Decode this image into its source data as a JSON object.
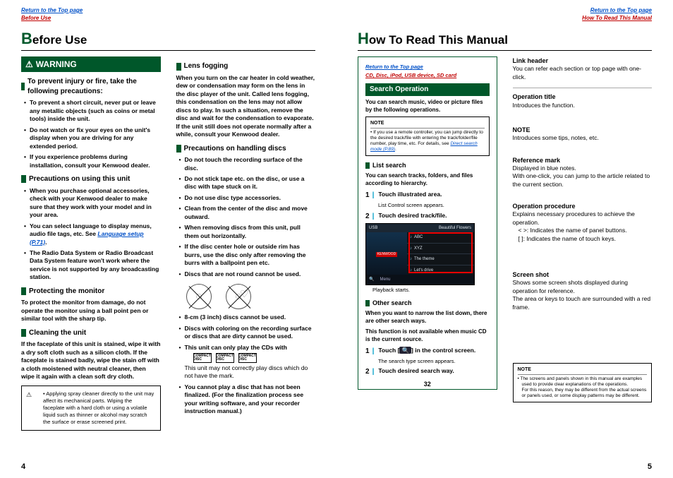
{
  "left": {
    "top_link_blue": "Return to the Top page",
    "top_link_red": "Before Use",
    "title_cap": "B",
    "title_rest": "efore Use",
    "warning_label": "WARNING",
    "warn_heading": "To prevent injury or fire, take the following precautions:",
    "warn_items": [
      "To prevent a short circuit, never put or leave any metallic objects (such as coins or metal tools) inside the unit.",
      "Do not watch or fix your eyes on the unit's display when you are driving for any extended period.",
      "If you experience problems during installation, consult your Kenwood dealer."
    ],
    "h_using": "Precautions on using this unit",
    "using_items_pre": "When you purchase optional accessories, check with your Kenwood dealer to make sure that they work with your model and in your area.",
    "using_item2_a": "You can select language to display menus, audio file tags, etc. See ",
    "using_item2_link": "Language setup (P.71)",
    "using_item2_b": ".",
    "using_item3": "The Radio Data System or Radio Broadcast Data System feature won't work where the service is not supported by any broadcasting station.",
    "h_protect": "Protecting the monitor",
    "protect_text": "To protect the monitor from damage, do not operate the monitor using a ball point pen or similar tool with the sharp tip.",
    "h_clean": "Cleaning the unit",
    "clean_text": "If the faceplate of this unit is stained, wipe it with a dry soft cloth such as a silicon cloth. If the faceplate is stained badly, wipe the stain off with a cloth moistened with neutral cleaner, then wipe it again with a clean soft dry cloth.",
    "clean_note": "Applying spray cleaner directly to the unit may affect its mechanical parts. Wiping the faceplate with a hard cloth or using a volatile liquid such as thinner or alcohol may scratch the surface or erase screened print.",
    "h_fog": "Lens fogging",
    "fog_text": "When you turn on the car heater in cold weather, dew or condensation may form on the lens in the disc player of the unit. Called lens fogging, this condensation on the lens may not allow discs to play. In such a situation, remove the disc and wait for the condensation to evaporate. If the unit still does not operate normally after a while, consult your Kenwood dealer.",
    "h_disc": "Precautions on handling discs",
    "disc_items_a": [
      "Do not touch the recording surface of the disc.",
      "Do not stick tape etc. on the disc, or use a disc with tape stuck on it.",
      "Do not use disc type accessories.",
      "Clean from the center of the disc and move outward.",
      "When removing discs from this unit, pull them out horizontally.",
      "If the disc center hole or outside rim has burrs, use the disc only after removing the burrs with a ballpoint pen etc.",
      "Discs that are not round cannot be used."
    ],
    "disc_items_b1": "8-cm (3 inch) discs cannot be used.",
    "disc_items_b2": "Discs with coloring on the recording surface or discs that are dirty cannot be used.",
    "disc_items_b3": "This unit can only play the CDs with",
    "disc_items_b3_sub": "This unit may not correctly play discs which do not have the mark.",
    "disc_items_b4": "You cannot play a disc that has not been finalized. (For the finalization process see your writing software, and your recorder instruction manual.)",
    "page_num": "4"
  },
  "right": {
    "top_link_blue": "Return to the Top page",
    "top_link_red": "How To Read This Manual",
    "title_cap": "H",
    "title_rest": "ow To Read This Manual",
    "ex_top_blue": "Return to the Top page",
    "ex_top_red": "CD, Disc, iPod, USB device, SD card",
    "ex_bar": "Search Operation",
    "ex_intro": "You can search music, video or picture files by the following operations.",
    "ex_note_title": "NOTE",
    "ex_note_body_a": "If you use a remote controller, you can jump directly to the desired track/file with entering the track/folder/file number, play time, etc. For details, see ",
    "ex_note_link": "Direct search mode (P.89)",
    "ex_note_body_b": ".",
    "h_list": "List search",
    "list_intro": "You can search tracks, folders, and files according to hierarchy.",
    "step1": "Touch illustrated area.",
    "step1_sub": "List Control screen appears.",
    "step2": "Touch desired track/file.",
    "shot_top_l": "USB",
    "shot_top_r": "Beautiful Flowers",
    "shot_brand": "KENWOOD",
    "shot_rows": [
      "ABC",
      "XYZ",
      "The theme",
      "Let's drive"
    ],
    "shot_play_label": "Playback starts.",
    "h_other": "Other search",
    "other_p1": "When you want to narrow the list down, there are other search ways.",
    "other_p2": "This function is not available when music CD is the current source.",
    "ostep1_a": "Touch [",
    "ostep1_b": "] in the control screen.",
    "ostep1_sub": "The search type screen appears.",
    "ostep2": "Touch desired search way.",
    "ex_page": "32",
    "defs": [
      {
        "t": "Link header",
        "d": "You can refer each section or top page with one-click."
      },
      {
        "t": "Operation title",
        "d": "Introduces the function."
      },
      {
        "t": "NOTE",
        "d": "Introduces some tips, notes, etc."
      },
      {
        "t": "Reference mark",
        "d": "Displayed in blue notes.\nWith one-click, you can jump to the article related to the current section."
      },
      {
        "t": "Operation procedure",
        "d": "Explains necessary procedures to achieve the operation."
      },
      {
        "t": "Screen shot",
        "d": "Shows some screen shots displayed during operation for reference.\nThe area or keys to touch are surrounded with a red frame."
      }
    ],
    "proc_hint1": "<    >: Indicates the name of panel buttons.",
    "proc_hint2": "[     ]: Indicates the name of touch keys.",
    "rnote_title": "NOTE",
    "rnote_body": "The screens and panels shown in this manual are examples used to provide clear explanations of the operations.\nFor this reason, they may be different from the actual screens or panels used, or some display patterns may be different.",
    "page_num": "5"
  }
}
